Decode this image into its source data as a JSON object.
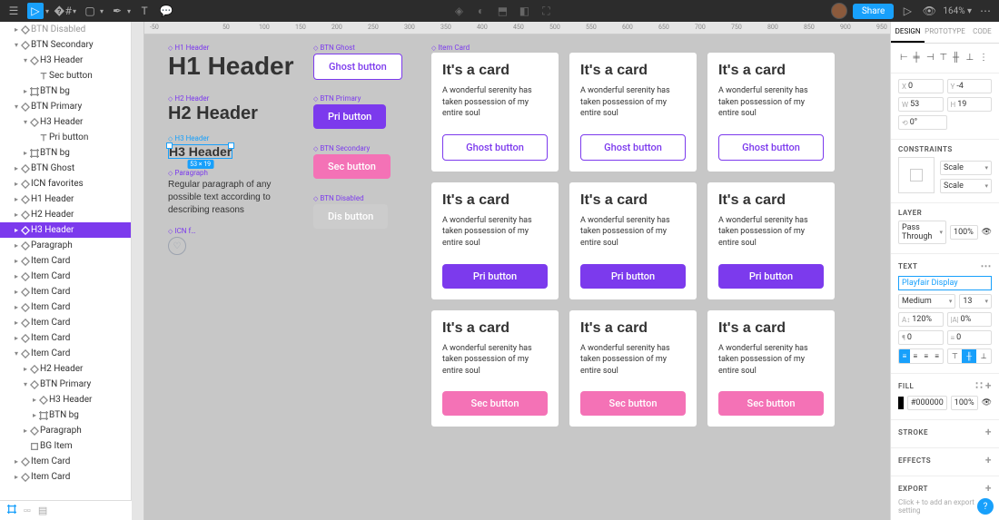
{
  "topbar": {
    "share": "Share",
    "zoom": "164%"
  },
  "layers": [
    {
      "d": 1,
      "ic": "comp",
      "t": "BTN Disabled",
      "a": ">",
      "c": "faded"
    },
    {
      "d": 1,
      "ic": "comp",
      "t": "BTN Secondary",
      "a": "v"
    },
    {
      "d": 2,
      "ic": "comp",
      "t": "H3 Header",
      "a": "v"
    },
    {
      "d": 3,
      "ic": "text",
      "t": "Sec button"
    },
    {
      "d": 2,
      "ic": "frame",
      "t": "BTN bg",
      "a": ">"
    },
    {
      "d": 1,
      "ic": "comp",
      "t": "BTN Primary",
      "a": "v"
    },
    {
      "d": 2,
      "ic": "comp",
      "t": "H3 Header",
      "a": "v"
    },
    {
      "d": 3,
      "ic": "text",
      "t": "Pri button"
    },
    {
      "d": 2,
      "ic": "frame",
      "t": "BTN bg",
      "a": ">"
    },
    {
      "d": 1,
      "ic": "comp",
      "t": "BTN Ghost",
      "a": ">"
    },
    {
      "d": 1,
      "ic": "comp",
      "t": "ICN favorites",
      "a": ">"
    },
    {
      "d": 1,
      "ic": "comp",
      "t": "H1 Header",
      "a": ">"
    },
    {
      "d": 1,
      "ic": "comp",
      "t": "H2 Header",
      "a": ">"
    },
    {
      "d": 1,
      "ic": "comp",
      "t": "H3 Header",
      "a": ">",
      "sel": true
    },
    {
      "d": 1,
      "ic": "comp",
      "t": "Paragraph",
      "a": ">"
    },
    {
      "d": 1,
      "ic": "comp",
      "t": "Item Card",
      "a": ">"
    },
    {
      "d": 1,
      "ic": "comp",
      "t": "Item Card",
      "a": ">"
    },
    {
      "d": 1,
      "ic": "comp",
      "t": "Item Card",
      "a": ">"
    },
    {
      "d": 1,
      "ic": "comp",
      "t": "Item Card",
      "a": ">"
    },
    {
      "d": 1,
      "ic": "comp",
      "t": "Item Card",
      "a": ">"
    },
    {
      "d": 1,
      "ic": "comp",
      "t": "Item Card",
      "a": ">"
    },
    {
      "d": 1,
      "ic": "comp",
      "t": "Item Card",
      "a": "v"
    },
    {
      "d": 2,
      "ic": "comp",
      "t": "H2 Header",
      "a": ">"
    },
    {
      "d": 2,
      "ic": "comp",
      "t": "BTN Primary",
      "a": "v"
    },
    {
      "d": 3,
      "ic": "comp",
      "t": "H3 Header",
      "a": ">"
    },
    {
      "d": 3,
      "ic": "frame",
      "t": "BTN bg",
      "a": ">"
    },
    {
      "d": 2,
      "ic": "comp",
      "t": "Paragraph",
      "a": ">"
    },
    {
      "d": 2,
      "ic": "rect",
      "t": "BG Item"
    },
    {
      "d": 1,
      "ic": "comp",
      "t": "Item Card",
      "a": ">"
    },
    {
      "d": 1,
      "ic": "comp",
      "t": "Item Card",
      "a": ">"
    }
  ],
  "canvas": {
    "ticks": [
      "-50",
      "",
      "50",
      "100",
      "150",
      "200",
      "250",
      "300",
      "350",
      "400",
      "450",
      "500",
      "550",
      "600",
      "650",
      "700",
      "750",
      "800",
      "850",
      "900",
      "950"
    ],
    "labels": {
      "h1": "H1 Header",
      "h2": "H2 Header",
      "h3": "H3 Header",
      "para": "Paragraph",
      "bghost": "BTN Ghost",
      "bpri": "BTN Primary",
      "bsec": "BTN Secondary",
      "bdis": "BTN Disabled",
      "icn": "ICN f…",
      "card": "Item Card"
    },
    "text": {
      "h1": "H1 Header",
      "h2": "H2 Header",
      "h3": "H3 Header",
      "para": "Regular paragraph of any possible text according to describing reasons",
      "ghost": "Ghost button",
      "pri": "Pri button",
      "sec": "Sec button",
      "dis": "Dis button",
      "cardTitle": "It's a card",
      "cardBody": "A wonderful serenity has taken possession of my entire soul",
      "selDims": "53 × 19"
    }
  },
  "right": {
    "tabs": [
      "DESIGN",
      "PROTOTYPE",
      "CODE"
    ],
    "pos": {
      "x": "0",
      "y": "-4",
      "w": "53",
      "h": "19",
      "r": "0°"
    },
    "constraints": {
      "title": "CONSTRAINTS",
      "h": "Scale",
      "v": "Scale"
    },
    "layer": {
      "title": "LAYER",
      "blend": "Pass Through",
      "opacity": "100%"
    },
    "text": {
      "title": "TEXT",
      "font": "Playfair Display",
      "weight": "Medium",
      "size": "13",
      "lh": "120%",
      "ls": "0%",
      "pa": "0",
      "pb": "0"
    },
    "fill": {
      "title": "FILL",
      "hex": "#000000",
      "opacity": "100%"
    },
    "stroke": {
      "title": "STROKE"
    },
    "effects": {
      "title": "EFFECTS"
    },
    "export": {
      "title": "EXPORT",
      "hint": "Click + to add an export setting"
    }
  }
}
